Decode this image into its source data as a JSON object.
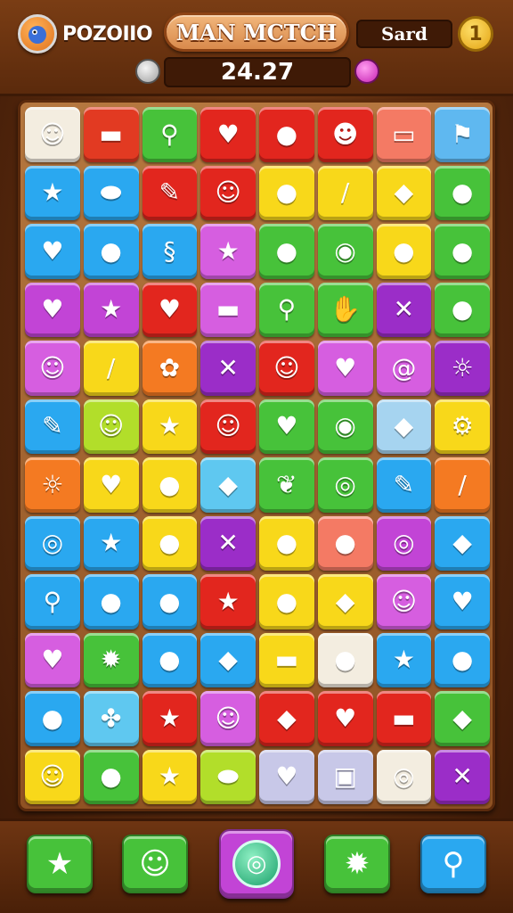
{
  "header": {
    "player_name": "POZOIIO",
    "title": "MAN MCTCH",
    "score_label": "Sard",
    "coin_symbol": "1",
    "timer": "24.27"
  },
  "board": {
    "rows": 12,
    "cols": 8,
    "tiles": [
      [
        {
          "color": "#f3ede0",
          "glyph": "☺",
          "icon": "orange-face"
        },
        {
          "color": "#e23a22",
          "glyph": "▬",
          "icon": "orange-box"
        },
        {
          "color": "#47c23a",
          "glyph": "⚲",
          "icon": "magnifier"
        },
        {
          "color": "#e2261e",
          "glyph": "♥",
          "icon": "red-apple"
        },
        {
          "color": "#e2261e",
          "glyph": "●",
          "icon": "red-fruit"
        },
        {
          "color": "#e2261e",
          "glyph": "☻",
          "icon": "red-face"
        },
        {
          "color": "#f47a64",
          "glyph": "▭",
          "icon": "tape"
        },
        {
          "color": "#5fb8f0",
          "glyph": "⚑",
          "icon": "flag"
        }
      ],
      [
        {
          "color": "#2aa8f0",
          "glyph": "★",
          "icon": "yellow-star"
        },
        {
          "color": "#2aa8f0",
          "glyph": "⬬",
          "icon": "blue-candy"
        },
        {
          "color": "#e2261e",
          "glyph": "✎",
          "icon": "pencil"
        },
        {
          "color": "#e2261e",
          "glyph": "☺",
          "icon": "yellow-face"
        },
        {
          "color": "#f8d81a",
          "glyph": "●",
          "icon": "purple-drop"
        },
        {
          "color": "#f8d81a",
          "glyph": "/",
          "icon": "green-stick"
        },
        {
          "color": "#f8d81a",
          "glyph": "◆",
          "icon": "blue-shape"
        },
        {
          "color": "#47c23a",
          "glyph": "●",
          "icon": "yellow-fruit"
        }
      ],
      [
        {
          "color": "#2aa8f0",
          "glyph": "♥",
          "icon": "orange-heart"
        },
        {
          "color": "#2aa8f0",
          "glyph": "●",
          "icon": "orange-fruit"
        },
        {
          "color": "#2aa8f0",
          "glyph": "§",
          "icon": "blue-swirl"
        },
        {
          "color": "#d65ee0",
          "glyph": "★",
          "icon": "blue-star"
        },
        {
          "color": "#47c23a",
          "glyph": "●",
          "icon": "red-apple"
        },
        {
          "color": "#47c23a",
          "glyph": "◉",
          "icon": "green-creature"
        },
        {
          "color": "#f8d81a",
          "glyph": "●",
          "icon": "red-pepper"
        },
        {
          "color": "#47c23a",
          "glyph": "●",
          "icon": "cherries"
        }
      ],
      [
        {
          "color": "#c244d6",
          "glyph": "♥",
          "icon": "purple-heart"
        },
        {
          "color": "#c244d6",
          "glyph": "★",
          "icon": "paper-plane"
        },
        {
          "color": "#e2261e",
          "glyph": "♥",
          "icon": "red-heart"
        },
        {
          "color": "#d65ee0",
          "glyph": "▬",
          "icon": "blue-bar"
        },
        {
          "color": "#47c23a",
          "glyph": "⚲",
          "icon": "lollipop"
        },
        {
          "color": "#47c23a",
          "glyph": "✋",
          "icon": "yellow-hand"
        },
        {
          "color": "#9b2dc8",
          "glyph": "✕",
          "icon": "x-mark"
        },
        {
          "color": "#47c23a",
          "glyph": "●",
          "icon": "yellow-blob"
        }
      ],
      [
        {
          "color": "#d65ee0",
          "glyph": "☺",
          "icon": "yellow-face"
        },
        {
          "color": "#f8d81a",
          "glyph": "/",
          "icon": "green-stick"
        },
        {
          "color": "#f47a22",
          "glyph": "✿",
          "icon": "leaf-lolly"
        },
        {
          "color": "#9b2dc8",
          "glyph": "✕",
          "icon": "x-mark"
        },
        {
          "color": "#e2261e",
          "glyph": "☺",
          "icon": "yellow-face"
        },
        {
          "color": "#d65ee0",
          "glyph": "♥",
          "icon": "purple-heart"
        },
        {
          "color": "#d65ee0",
          "glyph": "@",
          "icon": "swirl"
        },
        {
          "color": "#9b2dc8",
          "glyph": "☼",
          "icon": "sun"
        }
      ],
      [
        {
          "color": "#2aa8f0",
          "glyph": "✎",
          "icon": "pencil"
        },
        {
          "color": "#b2de2a",
          "glyph": "☺",
          "icon": "face"
        },
        {
          "color": "#f8d81a",
          "glyph": "★",
          "icon": "pink-star"
        },
        {
          "color": "#e2261e",
          "glyph": "☺",
          "icon": "yellow-face"
        },
        {
          "color": "#47c23a",
          "glyph": "♥",
          "icon": "purple-heart"
        },
        {
          "color": "#47c23a",
          "glyph": "◉",
          "icon": "eye"
        },
        {
          "color": "#a6d4f0",
          "glyph": "◆",
          "icon": "yellow-drop"
        },
        {
          "color": "#f8d81a",
          "glyph": "⚙",
          "icon": "gear"
        }
      ],
      [
        {
          "color": "#f47a22",
          "glyph": "☼",
          "icon": "sun"
        },
        {
          "color": "#f8d81a",
          "glyph": "♥",
          "icon": "purple-heart"
        },
        {
          "color": "#f8d81a",
          "glyph": "●",
          "icon": "red-apple"
        },
        {
          "color": "#5fc8f0",
          "glyph": "◆",
          "icon": "blue-heart"
        },
        {
          "color": "#47c23a",
          "glyph": "❦",
          "icon": "leaf"
        },
        {
          "color": "#47c23a",
          "glyph": "◎",
          "icon": "ring"
        },
        {
          "color": "#2aa8f0",
          "glyph": "✎",
          "icon": "pencil"
        },
        {
          "color": "#f47a22",
          "glyph": "/",
          "icon": "blue-stick"
        }
      ],
      [
        {
          "color": "#2aa8f0",
          "glyph": "◎",
          "icon": "purple-swirl"
        },
        {
          "color": "#2aa8f0",
          "glyph": "★",
          "icon": "green-star"
        },
        {
          "color": "#f8d81a",
          "glyph": "●",
          "icon": "pink-blob"
        },
        {
          "color": "#9b2dc8",
          "glyph": "✕",
          "icon": "x-mark"
        },
        {
          "color": "#f8d81a",
          "glyph": "●",
          "icon": "pink-bean"
        },
        {
          "color": "#f47a64",
          "glyph": "●",
          "icon": "yellow-drop"
        },
        {
          "color": "#c244d6",
          "glyph": "◎",
          "icon": "blue-ring"
        },
        {
          "color": "#2aa8f0",
          "glyph": "◆",
          "icon": "yellow-lemon"
        }
      ],
      [
        {
          "color": "#2aa8f0",
          "glyph": "⚲",
          "icon": "green-lollipop"
        },
        {
          "color": "#2aa8f0",
          "glyph": "●",
          "icon": "red-ball"
        },
        {
          "color": "#2aa8f0",
          "glyph": "●",
          "icon": "purple-blob"
        },
        {
          "color": "#e2261e",
          "glyph": "★",
          "icon": "red-star"
        },
        {
          "color": "#f8d81a",
          "glyph": "●",
          "icon": "white-egg"
        },
        {
          "color": "#f8d81a",
          "glyph": "◆",
          "icon": "green-cube"
        },
        {
          "color": "#d65ee0",
          "glyph": "☺",
          "icon": "yellow-face"
        },
        {
          "color": "#2aa8f0",
          "glyph": "♥",
          "icon": "orange-heart"
        }
      ],
      [
        {
          "color": "#d65ee0",
          "glyph": "♥",
          "icon": "red-heart"
        },
        {
          "color": "#47c23a",
          "glyph": "✹",
          "icon": "orange-creature"
        },
        {
          "color": "#2aa8f0",
          "glyph": "●",
          "icon": "purple-blob"
        },
        {
          "color": "#2aa8f0",
          "glyph": "◆",
          "icon": "yellow-cheese"
        },
        {
          "color": "#f8d81a",
          "glyph": "▬",
          "icon": "blue-bar"
        },
        {
          "color": "#f3ede0",
          "glyph": "●",
          "icon": "green-ball"
        },
        {
          "color": "#2aa8f0",
          "glyph": "★",
          "icon": "green-star"
        },
        {
          "color": "#2aa8f0",
          "glyph": "●",
          "icon": "red-apple"
        }
      ],
      [
        {
          "color": "#2aa8f0",
          "glyph": "●",
          "icon": "green-ball"
        },
        {
          "color": "#5fc8f0",
          "glyph": "✤",
          "icon": "purple-candy"
        },
        {
          "color": "#e2261e",
          "glyph": "★",
          "icon": "green-leaf"
        },
        {
          "color": "#d65ee0",
          "glyph": "☺",
          "icon": "yellow-face"
        },
        {
          "color": "#e2261e",
          "glyph": "◆",
          "icon": "blue-crystal"
        },
        {
          "color": "#e2261e",
          "glyph": "♥",
          "icon": "yellow-heart"
        },
        {
          "color": "#e2261e",
          "glyph": "▬",
          "icon": "blue-stick"
        },
        {
          "color": "#47c23a",
          "glyph": "◆",
          "icon": "yellow-diamond"
        }
      ],
      [
        {
          "color": "#f8d81a",
          "glyph": "☺",
          "icon": "yellow-face"
        },
        {
          "color": "#47c23a",
          "glyph": "●",
          "icon": "blue-apple"
        },
        {
          "color": "#f8d81a",
          "glyph": "★",
          "icon": "red-star"
        },
        {
          "color": "#b2de2a",
          "glyph": "⬬",
          "icon": "blue-pill"
        },
        {
          "color": "#c8c8e8",
          "glyph": "♥",
          "icon": "purple-heart"
        },
        {
          "color": "#c8c8e8",
          "glyph": "▣",
          "icon": "box"
        },
        {
          "color": "#f3ede0",
          "glyph": "◎",
          "icon": "green-ring"
        },
        {
          "color": "#9b2dc8",
          "glyph": "✕",
          "icon": "swords"
        }
      ]
    ]
  },
  "powerups": [
    {
      "name": "star-powerup",
      "color": "#47c23a",
      "glyph": "★",
      "icon": "star-icon"
    },
    {
      "name": "creature-powerup",
      "color": "#47c23a",
      "glyph": "☺",
      "icon": "cloud-creature-icon"
    },
    {
      "name": "target-powerup",
      "color": "#c244d6",
      "glyph": "◎",
      "icon": "target-icon"
    },
    {
      "name": "splat-powerup",
      "color": "#47c23a",
      "glyph": "✹",
      "icon": "splat-icon"
    },
    {
      "name": "search-powerup",
      "color": "#2aa8f0",
      "glyph": "⚲",
      "icon": "search-icon"
    }
  ]
}
